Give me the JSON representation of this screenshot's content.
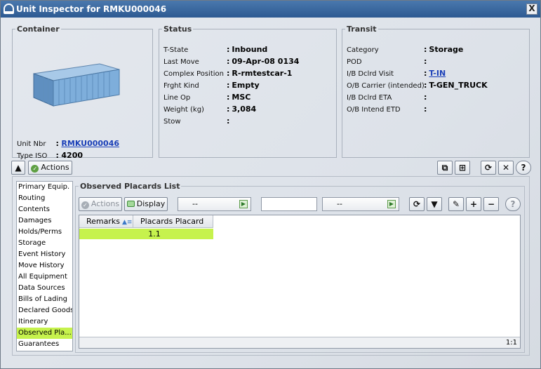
{
  "window": {
    "title": "Unit Inspector for RMKU000046",
    "close_glyph": "X"
  },
  "container": {
    "legend": "Container",
    "fields": [
      {
        "label": "Unit Nbr",
        "sep": ":",
        "value": "RMKU000046"
      },
      {
        "label": "Type ISO",
        "sep": ":",
        "value": "4200"
      }
    ]
  },
  "status": {
    "legend": "Status",
    "fields": [
      {
        "label": "T-State",
        "sep": ":",
        "value": "Inbound"
      },
      {
        "label": "Last Move",
        "sep": ":",
        "value": "09-Apr-08 0134"
      },
      {
        "label": "Complex Position",
        "sep": ":",
        "value": "R-rmtestcar-1"
      },
      {
        "label": "Frght Kind",
        "sep": ":",
        "value": "Empty"
      },
      {
        "label": "Line Op",
        "sep": ":",
        "value": "MSC"
      },
      {
        "label": "Weight (kg)",
        "sep": ":",
        "value": "3,084"
      },
      {
        "label": "Stow",
        "sep": ":",
        "value": ""
      }
    ]
  },
  "transit": {
    "legend": "Transit",
    "fields": [
      {
        "label": "Category",
        "sep": ":",
        "value": "Storage"
      },
      {
        "label": "POD",
        "sep": ":",
        "value": ""
      },
      {
        "label": "I/B Dclrd Visit",
        "sep": ":",
        "value": "T-IN"
      },
      {
        "label": "O/B Carrier (intended)",
        "sep": ":",
        "value": "T-GEN_TRUCK"
      },
      {
        "label": "I/B Dclrd ETA",
        "sep": ":",
        "value": ""
      },
      {
        "label": "O/B Intend ETD",
        "sep": ":",
        "value": ""
      }
    ]
  },
  "toolbar": {
    "collapse_glyph": "▲",
    "actions_label": "Actions"
  },
  "sidebar": {
    "items": [
      "Primary Equip.",
      "Routing",
      "Contents",
      "Damages",
      "Holds/Perms",
      "Storage",
      "Event History",
      "Move History",
      "All Equipment",
      "Data Sources",
      "Bills of Lading",
      "Declared Goods",
      "Itinerary",
      "Observed Pla...",
      "Guarantees"
    ],
    "selected_index": 13
  },
  "placards": {
    "legend": "Observed Placards List",
    "actions_label": "Actions",
    "display_label": "Display",
    "filter1_value": "--",
    "filter2_value": "--",
    "search_value": "",
    "columns": [
      "Remarks",
      "Placards Placard"
    ],
    "rows": [
      {
        "remarks": "",
        "placard": "1.1"
      }
    ],
    "footer": "1:1"
  },
  "colors": {
    "selected": "#c6f24d",
    "link": "#1a3fb8",
    "title_bar": "#2d5a92"
  }
}
